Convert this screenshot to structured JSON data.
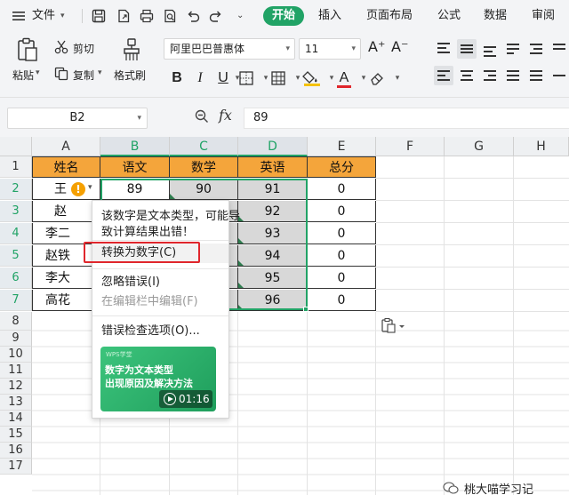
{
  "menu": {
    "file_label": "文件",
    "tabs": [
      "开始",
      "插入",
      "页面布局",
      "公式",
      "数据",
      "审阅"
    ]
  },
  "ribbon": {
    "paste_label": "粘贴",
    "cut_label": "剪切",
    "copy_label": "复制",
    "format_painter_label": "格式刷",
    "font_name": "阿里巴巴普惠体",
    "font_size": "11",
    "bold": "B",
    "italic": "I",
    "underline": "U",
    "font_color_letter": "A",
    "grow_font": "A⁺",
    "shrink_font": "A⁻"
  },
  "formula_bar": {
    "name_box": "B2",
    "fx": "fx",
    "value": "89"
  },
  "sheet": {
    "columns": [
      "A",
      "B",
      "C",
      "D",
      "E",
      "F",
      "G",
      "H"
    ],
    "rows": [
      "1",
      "2",
      "3",
      "4",
      "5",
      "6",
      "7",
      "8",
      "9",
      "10",
      "11",
      "12",
      "13",
      "14",
      "15",
      "16",
      "17"
    ],
    "header_row": [
      "姓名",
      "语文",
      "数学",
      "英语",
      "总分"
    ],
    "data": [
      [
        "王",
        "89",
        "90",
        "91",
        "0"
      ],
      [
        "赵",
        "",
        "",
        "92",
        "0"
      ],
      [
        "李二",
        "",
        "",
        "93",
        "0"
      ],
      [
        "赵铁",
        "",
        "",
        "94",
        "0"
      ],
      [
        "李大",
        "",
        "",
        "95",
        "0"
      ],
      [
        "高花",
        "",
        "",
        "96",
        "0"
      ]
    ],
    "header_color": "#f4a53b",
    "selection_color": "#21a366"
  },
  "error_popup": {
    "message_line1": "该数字是文本类型，可能导",
    "message_line2": "致计算结果出错！",
    "convert_label": "转换为数字(C)",
    "ignore_label": "忽略错误(I)",
    "edit_in_bar_label": "在编辑栏中编辑(F)",
    "options_label": "错误检查选项(O)...",
    "video": {
      "tag": "WPS学堂",
      "title_line1": "数字为文本类型",
      "title_line2": "出现原因及解决方法",
      "duration": "01:16"
    }
  },
  "watermark": "桃大喵学习记"
}
